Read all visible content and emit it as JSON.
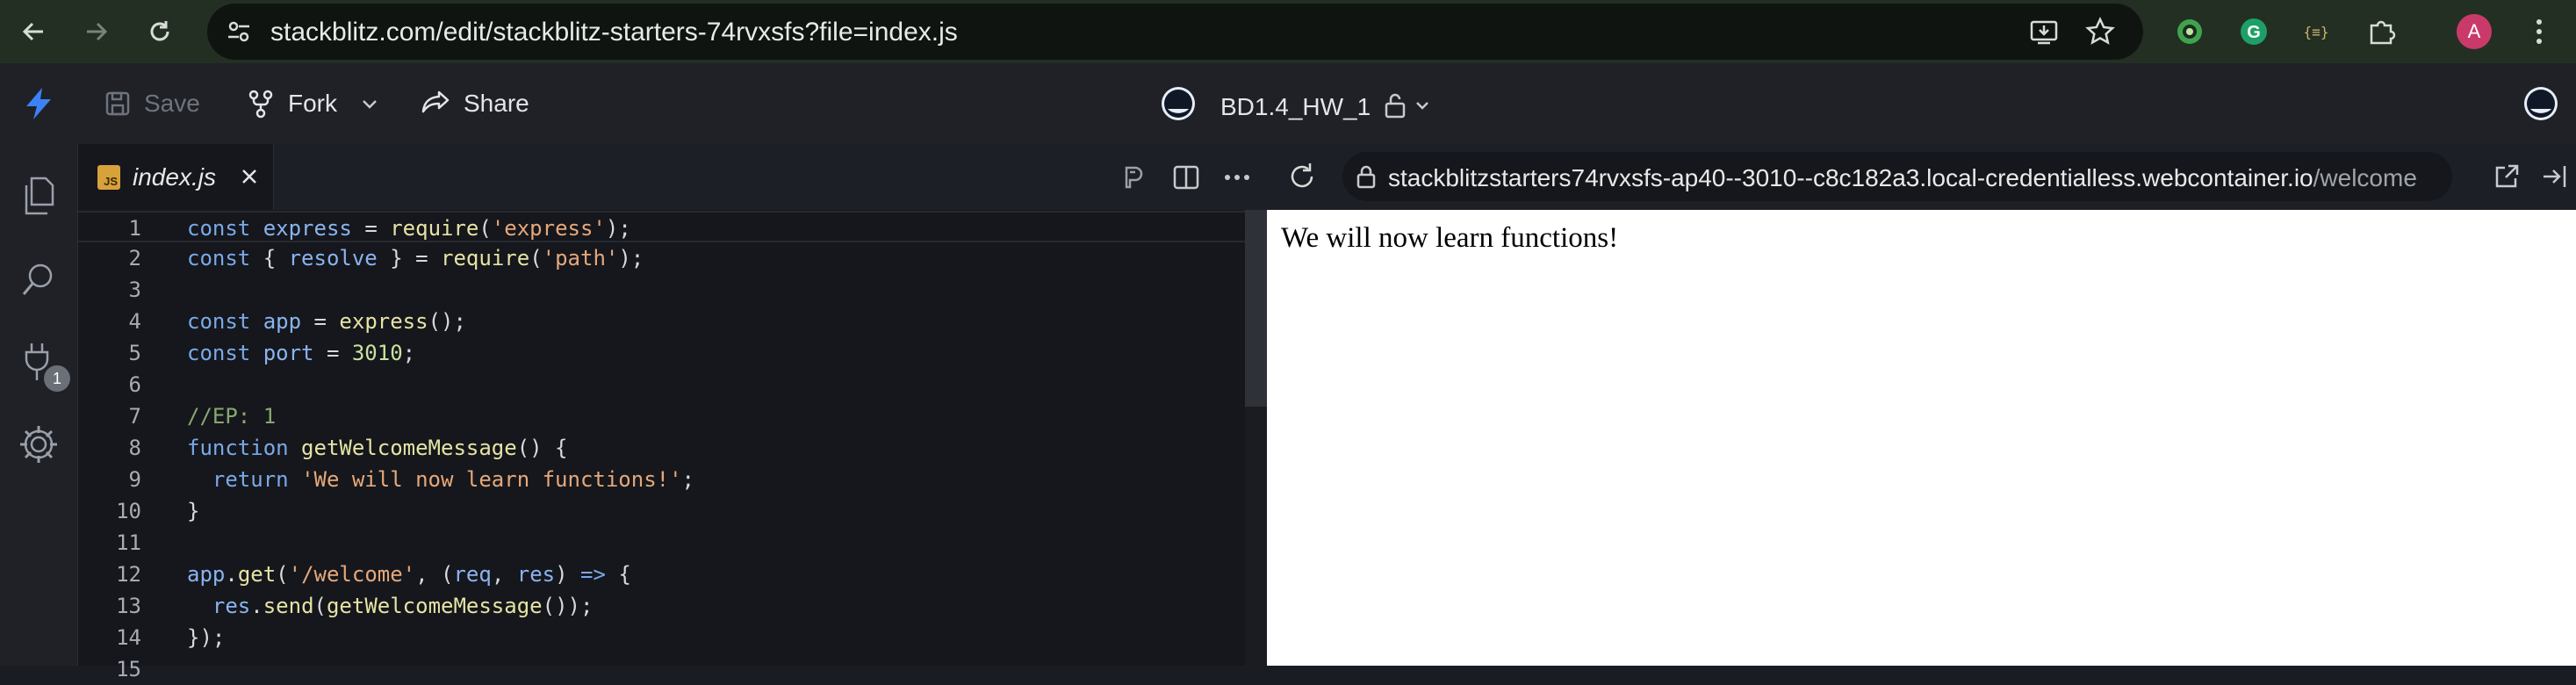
{
  "browser": {
    "url": "stackblitz.com/edit/stackblitz-starters-74rvxsfs?file=index.js",
    "profile_initial": "A",
    "extensions": [
      "circle-extension-icon",
      "grammarly-icon",
      "json-extension-icon",
      "puzzle-icon"
    ]
  },
  "header": {
    "save_label": "Save",
    "fork_label": "Fork",
    "share_label": "Share",
    "project_name": "BD1.4_HW_1"
  },
  "activity": {
    "badge_count": "1"
  },
  "editor": {
    "tab_label": "index.js",
    "lines": [
      {
        "n": "1",
        "code": "const express = require('express');"
      },
      {
        "n": "2",
        "code": "const { resolve } = require('path');"
      },
      {
        "n": "3",
        "code": ""
      },
      {
        "n": "4",
        "code": "const app = express();"
      },
      {
        "n": "5",
        "code": "const port = 3010;"
      },
      {
        "n": "6",
        "code": ""
      },
      {
        "n": "7",
        "code": "//EP: 1"
      },
      {
        "n": "8",
        "code": "function getWelcomeMessage() {"
      },
      {
        "n": "9",
        "code": "  return 'We will now learn functions!';"
      },
      {
        "n": "10",
        "code": "}"
      },
      {
        "n": "11",
        "code": ""
      },
      {
        "n": "12",
        "code": "app.get('/welcome', (req, res) => {"
      },
      {
        "n": "13",
        "code": "  res.send(getWelcomeMessage());"
      },
      {
        "n": "14",
        "code": "});"
      },
      {
        "n": "15",
        "code": ""
      }
    ]
  },
  "preview": {
    "url_host": "stackblitzstarters74rvxsfs-ap40--3010--c8c182a3.local-credentialless.webcontainer.io",
    "url_path": "/welcome",
    "content": "We will now learn functions!"
  },
  "colors": {
    "browser_bar": "#232f23",
    "editor_bg": "#15171c",
    "accent_bolt": "#3b82f6"
  }
}
